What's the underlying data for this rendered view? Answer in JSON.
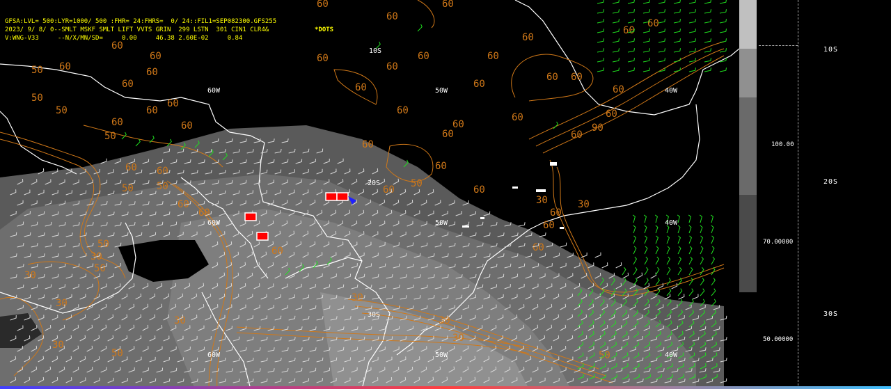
{
  "header": {
    "line1": "GFSA:LVL= 500:LYR=1000/ 500 :FHR= 24:FHRS=  0/ 24::FIL1=SEP082300.GFS255",
    "line2": "2023/ 9/ 8/ 0--SMLT MSKF SMLT LIFT VVTS GRIN  299 LSTN  301 CIN1 CLR4&",
    "line3": "V:WNG-V33     --N/X/MN/SD=     0.00     46.38 2.60E-02     0.84",
    "dots_label": "*DOTS"
  },
  "map_labels": {
    "lon_60w": "60W",
    "lon_50w": "50W",
    "lon_40w": "40W",
    "lat_20s": "20S",
    "lat_30s": "30S",
    "lat_10s": "10S",
    "c60": "60",
    "c50": "50",
    "c90": "90",
    "c30": "30"
  },
  "colorbar": {
    "label_100": "100.00",
    "label_70": "70.00000",
    "label_50": "50.00000",
    "colors": [
      "#e8e8e8",
      "#c0c0c0",
      "#909090",
      "#6a6a6a",
      "#4a4a4a"
    ]
  },
  "right_panel": {
    "lat_10s": "10S",
    "lat_20s": "20S",
    "lat_30s": "30S"
  },
  "colors": {
    "contour": "#d07818",
    "wind_green": "#20e020",
    "wind_white": "#d8d8d8",
    "coast": "#ffffff",
    "marker_red": "#ff0000",
    "header_yellow": "#ffff00"
  }
}
